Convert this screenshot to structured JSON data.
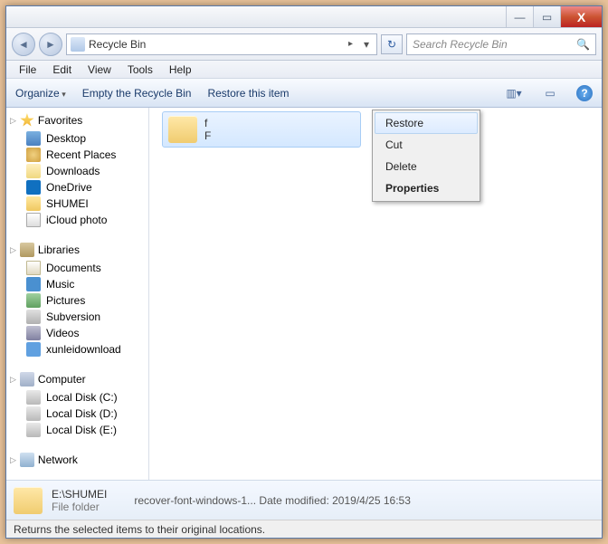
{
  "window": {
    "min": "—",
    "max": "▭",
    "close": "X"
  },
  "nav": {
    "back": "◄",
    "fwd": "►",
    "location": "Recycle Bin",
    "arrow": "▸",
    "dropdown": "▾",
    "refresh": "↻"
  },
  "search": {
    "placeholder": "Search Recycle Bin",
    "icon": "🔍"
  },
  "menu": {
    "file": "File",
    "edit": "Edit",
    "view": "View",
    "tools": "Tools",
    "help": "Help"
  },
  "toolbar": {
    "organize": "Organize",
    "empty": "Empty the Recycle Bin",
    "restore": "Restore this item",
    "views": "▥▾",
    "preview": "▭",
    "help": "?"
  },
  "sidebar": {
    "favorites": {
      "label": "Favorites",
      "items": [
        {
          "label": "Desktop",
          "ic": "ic-desktop"
        },
        {
          "label": "Recent Places",
          "ic": "ic-recent"
        },
        {
          "label": "Downloads",
          "ic": "ic-down"
        },
        {
          "label": "OneDrive",
          "ic": "ic-cloud"
        },
        {
          "label": "SHUMEI",
          "ic": "ic-folder"
        },
        {
          "label": "iCloud photo",
          "ic": "ic-photo"
        }
      ]
    },
    "libraries": {
      "label": "Libraries",
      "items": [
        {
          "label": "Documents",
          "ic": "ic-doc"
        },
        {
          "label": "Music",
          "ic": "ic-music"
        },
        {
          "label": "Pictures",
          "ic": "ic-pic"
        },
        {
          "label": "Subversion",
          "ic": "ic-sub"
        },
        {
          "label": "Videos",
          "ic": "ic-vid"
        },
        {
          "label": "xunleidownload",
          "ic": "ic-xun"
        }
      ]
    },
    "computer": {
      "label": "Computer",
      "items": [
        {
          "label": "Local Disk (C:)",
          "ic": "ic-disk"
        },
        {
          "label": "Local Disk (D:)",
          "ic": "ic-disk"
        },
        {
          "label": "Local Disk (E:)",
          "ic": "ic-disk"
        }
      ]
    },
    "network": {
      "label": "Network"
    }
  },
  "file": {
    "name_partial": "f",
    "type_partial": "F"
  },
  "context": {
    "restore": "Restore",
    "cut": "Cut",
    "delete": "Delete",
    "properties": "Properties"
  },
  "details": {
    "path": "E:\\SHUMEI",
    "type": "File folder",
    "name": "recover-font-windows-1...",
    "mod_label": "Date modified:",
    "mod_value": "2019/4/25 16:53"
  },
  "status": "Returns the selected items to their original locations."
}
